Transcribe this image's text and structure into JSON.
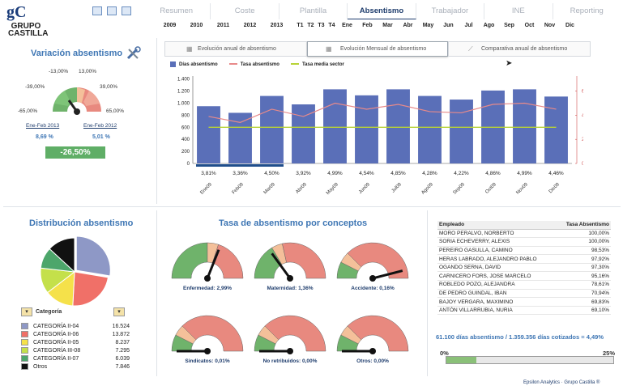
{
  "logo": {
    "brand": "gC",
    "line1": "GRUPO",
    "line2": "CASTILLA"
  },
  "toolbar_icons": [
    "table-icon",
    "report-icon",
    "grid-icon"
  ],
  "nav": [
    "Resumen",
    "Coste",
    "Plantilla",
    "Absentismo",
    "Trabajador",
    "INE",
    "Reporting"
  ],
  "nav_active": 3,
  "periods": [
    "2009",
    "2010",
    "2011",
    "2012",
    "2013",
    "T1",
    "T2",
    "T3",
    "T4",
    "Ene",
    "Feb",
    "Mar",
    "Abr",
    "May",
    "Jun",
    "Jul",
    "Ago",
    "Sep",
    "Oct",
    "Nov",
    "Dic"
  ],
  "variation": {
    "title": "Variación absentismo",
    "gauge_labels": [
      "-13,00%",
      "13,00%",
      "-39,00%",
      "39,00%",
      "-65,00%",
      "65,00%"
    ],
    "period_a": "Ene-Feb 2013",
    "val_a": "8,69 %",
    "period_b": "Ene-Feb 2012",
    "val_b": "5,01 %",
    "delta": "-26,50%"
  },
  "tabs": [
    "Evolución anual de absentismo",
    "Evolución Mensual de absentismo",
    "Comparativa anual de absentismo"
  ],
  "tab_active": 1,
  "chart_data": {
    "type": "bar",
    "title": "",
    "legend": [
      "Días absentismo",
      "Tasa absentismo",
      "Tasa media sector"
    ],
    "categories": [
      "Ene09",
      "Feb09",
      "Mar09",
      "Abr09",
      "May09",
      "Jun09",
      "Jul09",
      "Ago09",
      "Sep09",
      "Oct09",
      "Nov09",
      "Dic09"
    ],
    "bar_values": [
      950,
      840,
      1120,
      980,
      1230,
      1130,
      1230,
      1120,
      1060,
      1210,
      1230,
      1110
    ],
    "bar_labels": [
      "3,81%",
      "3,36%",
      "4,50%",
      "3,92%",
      "4,99%",
      "4,54%",
      "4,85%",
      "4,28%",
      "4,22%",
      "4,86%",
      "4,99%",
      "4,46%"
    ],
    "rate_values": [
      3.9,
      3.4,
      4.5,
      3.9,
      5.0,
      4.5,
      4.9,
      4.3,
      4.2,
      4.9,
      5.0,
      4.5
    ],
    "sector_values": [
      3.0,
      3.0,
      3.0,
      3.0,
      3.0,
      3.0,
      3.0,
      3.0,
      3.0,
      3.0,
      3.0,
      3.0
    ],
    "yticks": [
      "0",
      "200",
      "400",
      "600",
      "800",
      "1.000",
      "1.200",
      "1.400"
    ],
    "y2ticks": [
      "0%",
      "2%",
      "4%",
      "6%"
    ],
    "ylim": [
      0,
      1450
    ],
    "y2lim": [
      0,
      7.25
    ],
    "colors": {
      "bars": "#5a6fb8",
      "rate": "#e88a8a",
      "sector": "#b8d336"
    }
  },
  "distribution": {
    "title": "Distribución absentismo",
    "selector_label": "Categoría",
    "items": [
      {
        "name": "CATEGORÍA II-04",
        "value": "16.524",
        "color": "#8e98c6",
        "n": 16524
      },
      {
        "name": "CATEGORÍA II-06",
        "value": "13.872",
        "color": "#f07068",
        "n": 13872
      },
      {
        "name": "CATEGORÍA II-05",
        "value": "8.237",
        "color": "#f5e14a",
        "n": 8237
      },
      {
        "name": "CATEGORÍA III-08",
        "value": "7.295",
        "color": "#c4e04a",
        "n": 7295
      },
      {
        "name": "CATEGORÍA II-07",
        "value": "6.039",
        "color": "#4da66b",
        "n": 6039
      },
      {
        "name": "Otros",
        "value": "7.846",
        "color": "#111111",
        "n": 7846
      }
    ]
  },
  "concepts": {
    "title": "Tasa de absentismo por conceptos",
    "gauges": [
      {
        "label": "Enfermedad: 2,99%",
        "needle": 0.62
      },
      {
        "label": "Maternidad: 1,36%",
        "needle": 0.3
      },
      {
        "label": "Accidente: 0,16%",
        "needle": 0.92
      },
      {
        "label": "Sindicatos: 0,01%",
        "needle": 0.0
      },
      {
        "label": "No retribuidos: 0,00%",
        "needle": 0.0
      },
      {
        "label": "Otros: 0,00%",
        "needle": 0.0
      }
    ]
  },
  "employees": {
    "headers": [
      "Empleado",
      "Tasa Absentismo"
    ],
    "rows": [
      [
        "MORO PERALVO, NORBERTO",
        "100,00%"
      ],
      [
        "SORIA ECHEVERRY, ALEXIS",
        "100,00%"
      ],
      [
        "PEREIRO GASULLA, CAMINO",
        "98,53%"
      ],
      [
        "HERAS LABRADO, ALEJANDRO PABLO",
        "97,92%"
      ],
      [
        "OGANDO SERNA, DAVID",
        "97,30%"
      ],
      [
        "CARNICERO FORS, JOSE MARCELO",
        "95,16%"
      ],
      [
        "ROBLEDO POZO, ALEJANDRA",
        "78,61%"
      ],
      [
        "DE PEDRO GUINDAL, IBAN",
        "70,94%"
      ],
      [
        "BAJOY VERGARA, MAXIMINO",
        "69,83%"
      ],
      [
        "ANTÓN VILLARRUBIA, NURIA",
        "69,10%"
      ]
    ],
    "summary": "61.100 días absentismo / 1.359.356 días cotizados = 4,49%",
    "bar_min": "0%",
    "bar_max": "25%",
    "bar_level": 0.18
  },
  "footer": "Epsilon Analytics · Grupo Castilla ®"
}
